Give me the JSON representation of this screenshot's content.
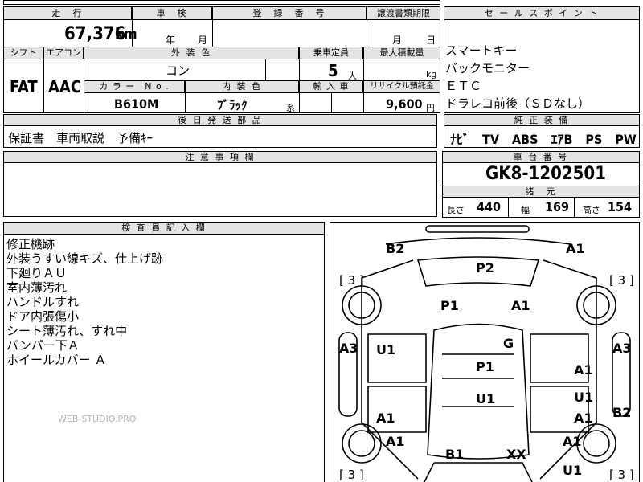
{
  "top_header": {
    "mileage": "走　行",
    "inspection": "車　検",
    "registration": "登　録　番　号",
    "transfer": "譲渡書類期限",
    "sales_points": "セ ー ル ス ポ イ ン ト"
  },
  "row1": {
    "mileage_value": "67,376",
    "mileage_unit": "km",
    "inspection_year": "年",
    "inspection_month": "月",
    "transfer_month": "月",
    "transfer_day": "日"
  },
  "row2_header": {
    "shift": "シフト",
    "aircon": "エアコン",
    "exterior_color": "外 装 色",
    "capacity": "乗車定員",
    "max_load": "最大積載量"
  },
  "row2": {
    "shift_value": "FAT",
    "aircon_value": "AAC",
    "exterior_color_value": "コン",
    "capacity_value": "5",
    "capacity_unit": "人",
    "max_load_unit": "kg"
  },
  "row3_header": {
    "color_no": "カ ラ ー　N o .",
    "interior_color": "内 装 色",
    "import": "輸 入 車",
    "recycle": "リサイクル預託金"
  },
  "row3": {
    "color_no_value": "B610M",
    "interior_color_value": "ﾌﾞﾗｯｸ",
    "interior_color_suffix": "系",
    "recycle_value": "9,600",
    "recycle_unit": "円"
  },
  "sales_points": [
    "スマートキー",
    "バックモニター",
    "ＥＴＣ",
    "ドラレコ前後（ＳＤなし）"
  ],
  "later_parts": {
    "header": "後 日 発 送 部 品",
    "value": "保証書　車両取説　予備ｷｰ"
  },
  "genuine_equipment": {
    "header": "純 正 装 備",
    "value": "ﾅﾋﾞ　TV　ABS　ｴｱB　PS　PW"
  },
  "notes": {
    "header": "注 意 事 項 欄"
  },
  "chassis": {
    "header": "車 台 番 号",
    "value": "GK8-1202501"
  },
  "dimensions": {
    "header": "諸　元",
    "length_label": "長さ",
    "length_value": "440",
    "width_label": "幅",
    "width_value": "169",
    "height_label": "高さ",
    "height_value": "154"
  },
  "inspector": {
    "header": "検 査 員 記 入 欄",
    "lines": [
      "修正機跡",
      "外装うすい線キズ、仕上げ跡",
      "下廻りＡＵ",
      "室内薄汚れ",
      "ハンドルすれ",
      "ドア内張傷小",
      "シート薄汚れ、すれ中",
      "バンパー下Ａ",
      "ホイールカバー Ａ"
    ]
  },
  "watermark": "WEB-STUDIO.PRO",
  "diagram": {
    "tire_marks": [
      "[ 3 ]",
      "[ 3 ]",
      "[ 3 ]",
      "[ 3 ]"
    ],
    "labels": [
      "B2",
      "A1",
      "P2",
      "P1",
      "A1",
      "A3",
      "U1",
      "G",
      "A3",
      "P1",
      "A1",
      "U1",
      "U1",
      "A1",
      "A1",
      "B2",
      "A1",
      "A1",
      "B1",
      "XX",
      "U1"
    ]
  }
}
